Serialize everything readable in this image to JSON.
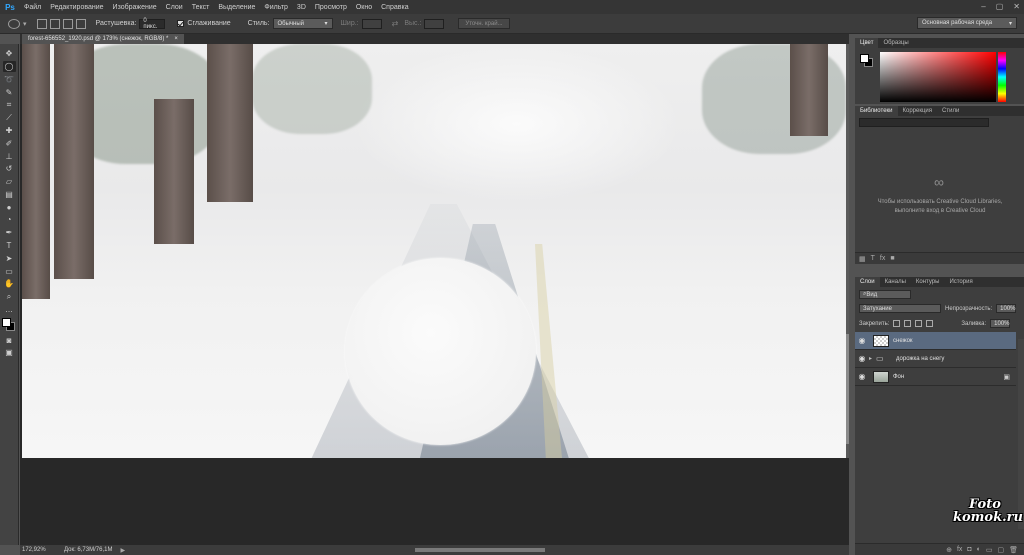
{
  "menubar": {
    "logo": "Ps",
    "items": [
      "Файл",
      "Редактирование",
      "Изображение",
      "Слои",
      "Текст",
      "Выделение",
      "Фильтр",
      "3D",
      "Просмотр",
      "Окно",
      "Справка"
    ],
    "window_controls": [
      "–",
      "▢",
      "✕"
    ]
  },
  "options": {
    "feather_label": "Растушевка:",
    "feather_value": "0 пикс.",
    "antialias_label": "Сглаживание",
    "style_label": "Стиль:",
    "style_value": "Обычный",
    "width_label": "Шир.:",
    "height_label": "Выс.:",
    "refine_edge": "Уточн. край...",
    "workspace": "Основная рабочая среда"
  },
  "document": {
    "tab_title": "forest-656552_1920.psd @ 173% (снежок, RGB/8) *",
    "close": "×"
  },
  "status": {
    "zoom": "172,92%",
    "doc_info": "Док: 6,73M/76,1M",
    "arrow": "▶"
  },
  "color_panel": {
    "tabs": [
      "Цвет",
      "Образцы"
    ],
    "foreground": "#ffffff",
    "background": "#000000"
  },
  "libraries_panel": {
    "tabs": [
      "Библиотеки",
      "Коррекция",
      "Стили"
    ],
    "message": "Чтобы использовать Creative Cloud Libraries, выполните вход в Creative Cloud",
    "cc_icon": "creative-cloud-icon"
  },
  "layers_panel": {
    "tabs": [
      "Слои",
      "Каналы",
      "Контуры",
      "История"
    ],
    "filter_kind": "Вид",
    "blend_mode": "Затухание",
    "opacity_label": "Непрозрачность:",
    "opacity_value": "100%",
    "lock_label": "Закрепить:",
    "fill_label": "Заливка:",
    "fill_value": "100%",
    "layers": [
      {
        "name": "снежок",
        "selected": true
      },
      {
        "name": "дорожка на снегу",
        "selected": false
      },
      {
        "name": "Фон",
        "selected": false
      }
    ]
  },
  "watermark": {
    "line1": "Foto",
    "line2": "komok.ru"
  }
}
